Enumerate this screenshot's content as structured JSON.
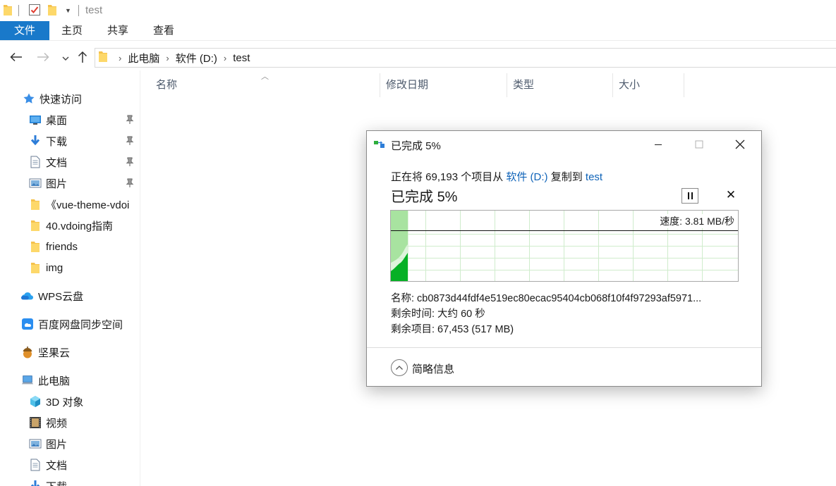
{
  "window": {
    "title": "test"
  },
  "ribbon": {
    "tabs": [
      "文件",
      "主页",
      "共享",
      "查看"
    ]
  },
  "breadcrumb": [
    "此电脑",
    "软件 (D:)",
    "test"
  ],
  "sidebar": {
    "quick_access": "快速访问",
    "items": [
      {
        "label": "桌面",
        "icon": "desktop-icon",
        "pinned": true
      },
      {
        "label": "下载",
        "icon": "download-icon",
        "pinned": true
      },
      {
        "label": "文档",
        "icon": "document-icon",
        "pinned": true
      },
      {
        "label": "图片",
        "icon": "picture-icon",
        "pinned": true
      },
      {
        "label": "《vue-theme-vdoi",
        "icon": "folder-icon",
        "pinned": false
      },
      {
        "label": "40.vdoing指南",
        "icon": "folder-icon",
        "pinned": false
      },
      {
        "label": "friends",
        "icon": "folder-icon",
        "pinned": false
      },
      {
        "label": "img",
        "icon": "folder-icon",
        "pinned": false
      }
    ],
    "wps": "WPS云盘",
    "baidu": "百度网盘同步空间",
    "jianguo": "坚果云",
    "this_pc": "此电脑",
    "pc_items": [
      {
        "label": "3D 对象",
        "icon": "cube-icon"
      },
      {
        "label": "视频",
        "icon": "video-icon"
      },
      {
        "label": "图片",
        "icon": "picture-icon"
      },
      {
        "label": "文档",
        "icon": "document-icon"
      },
      {
        "label": "下载",
        "icon": "download-icon"
      }
    ]
  },
  "columns": [
    "名称",
    "修改日期",
    "类型",
    "大小"
  ],
  "dialog": {
    "title": "已完成 5%",
    "line1_prefix": "正在将 69,193 个项目从 ",
    "source": "软件 (D:)",
    "line1_mid": " 复制到 ",
    "dest": "test",
    "status_label": "已完成",
    "percent": "5%",
    "progress": 0.05,
    "speed": "速度: 3.81 MB/秒",
    "name": "名称: cb0873d44fdf4e519ec80ecac95404cb068f10f4f97293af5971...",
    "time_left": "剩余时间: 大约 60 秒",
    "items_left": "剩余项目: 67,453 (517 MB)",
    "less_details": "简略信息"
  },
  "colors": {
    "accent": "#1979ca",
    "link": "#0f63b8",
    "graph_fill": "#06b025",
    "graph_light": "#a8e3a0"
  }
}
